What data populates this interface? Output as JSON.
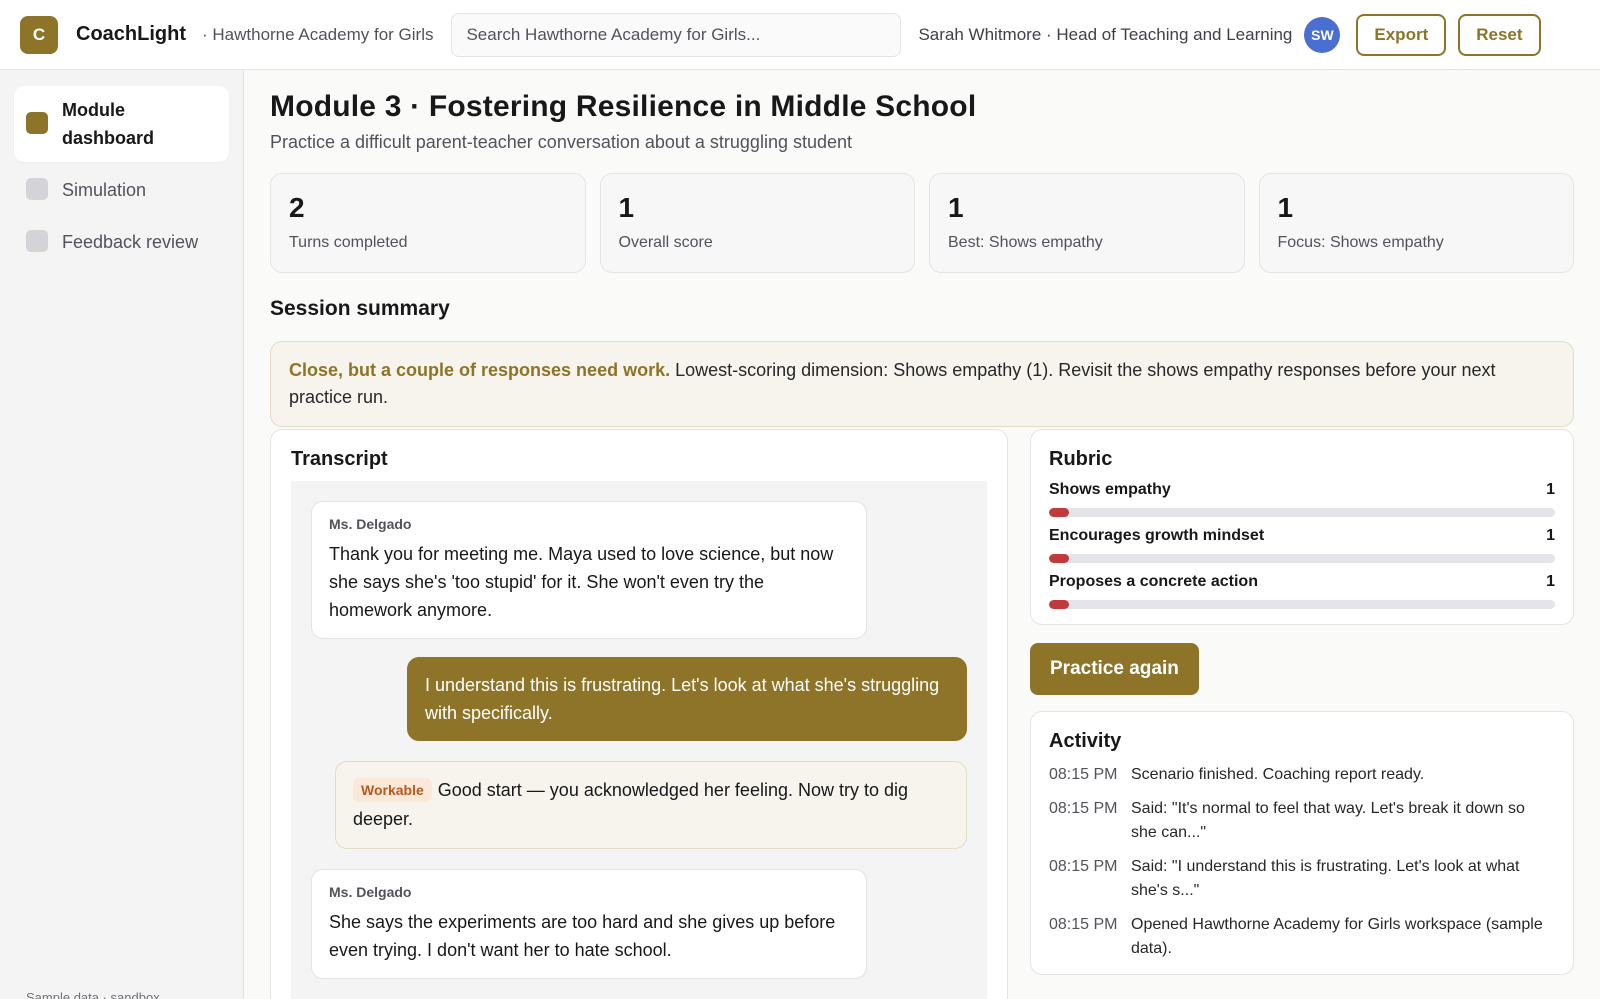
{
  "header": {
    "logo_letter": "C",
    "app_name": "CoachLight",
    "org_name": "· Hawthorne Academy for Girls",
    "search_placeholder": "Search Hawthorne Academy for Girls...",
    "user": "Sarah Whitmore · Head of Teaching and Learning",
    "avatar_initials": "SW",
    "export_label": "Export",
    "reset_label": "Reset"
  },
  "sidebar": {
    "items": [
      {
        "label": "Module dashboard",
        "active": true
      },
      {
        "label": "Simulation",
        "active": false
      },
      {
        "label": "Feedback review",
        "active": false
      }
    ],
    "footer": "Sample data · sandbox"
  },
  "page": {
    "title": "Module 3 · Fostering Resilience in Middle School",
    "subtitle": "Practice a difficult parent-teacher conversation about a struggling student"
  },
  "stats": [
    {
      "value": "2",
      "label": "Turns completed"
    },
    {
      "value": "1",
      "label": "Overall score"
    },
    {
      "value": "1",
      "label": "Best: Shows empathy"
    },
    {
      "value": "1",
      "label": "Focus: Shows empathy"
    }
  ],
  "summary": {
    "title": "Session summary",
    "strong": "Close, but a couple of responses need work.",
    "text": " Lowest-scoring dimension: Shows empathy (1). Revisit the shows empathy responses before your next practice run."
  },
  "transcript": {
    "title": "Transcript",
    "msg1_speaker": "Ms. Delgado",
    "msg1_text": "Thank you for meeting me. Maya used to love science, but now she says she's 'too stupid' for it. She won't even try the homework anymore.",
    "msg2_text": "I understand this is frustrating. Let's look at what she's struggling with specifically.",
    "feedback_badge": "Workable",
    "feedback_text": "Good start — you acknowledged her feeling. Now try to dig deeper.",
    "msg3_speaker": "Ms. Delgado",
    "msg3_text": "She says the experiments are too hard and she gives up before even trying. I don't want her to hate school."
  },
  "rubric": {
    "title": "Rubric",
    "max_score": 5,
    "items": [
      {
        "name": "Shows empathy",
        "score": "1",
        "fraction": 0.04
      },
      {
        "name": "Encourages growth mindset",
        "score": "1",
        "fraction": 0.04
      },
      {
        "name": "Proposes a concrete action",
        "score": "1",
        "fraction": 0.04
      }
    ],
    "fill_color": "#c0393b"
  },
  "practice_label": "Practice again",
  "activity": {
    "title": "Activity",
    "items": [
      {
        "time": "08:15 PM",
        "text": "Scenario finished. Coaching report ready."
      },
      {
        "time": "08:15 PM",
        "text": "Said: \"It's normal to feel that way. Let's break it down so she can...\""
      },
      {
        "time": "08:15 PM",
        "text": "Said: \"I understand this is frustrating. Let's look at what she's s...\""
      },
      {
        "time": "08:15 PM",
        "text": "Opened Hawthorne Academy for Girls workspace (sample data)."
      }
    ]
  },
  "colors": {
    "accent": "#8d7428",
    "avatar": "#4b6fd1",
    "badge_text": "#b45a1d",
    "score_low": "#c0393b"
  }
}
